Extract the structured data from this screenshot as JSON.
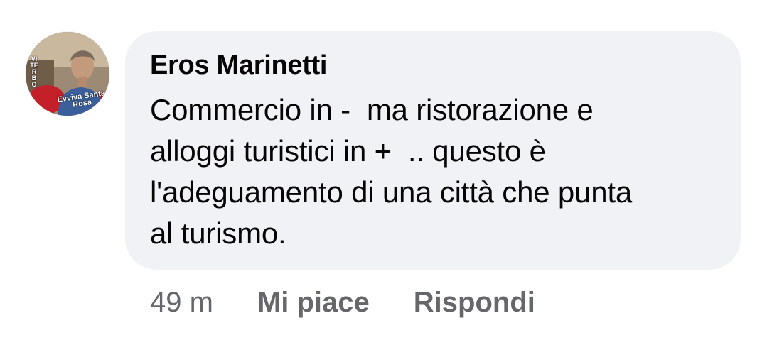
{
  "comment": {
    "avatar": {
      "icon": "user-photo-avatar",
      "badge_text": "Evviva Santa Rosa",
      "side_text": "VITERBO"
    },
    "author": "Eros Marinetti",
    "text": "Commercio in -  ma ristorazione e\nalloggi turistici in +  .. questo è\nl'adeguamento di una città che punta\nal turismo.",
    "timestamp": "49 m",
    "like_label": "Mi piace",
    "reply_label": "Rispondi"
  },
  "colors": {
    "bubble_background": "#f0f2f5",
    "text_primary": "#050505",
    "text_secondary": "#65676b"
  }
}
